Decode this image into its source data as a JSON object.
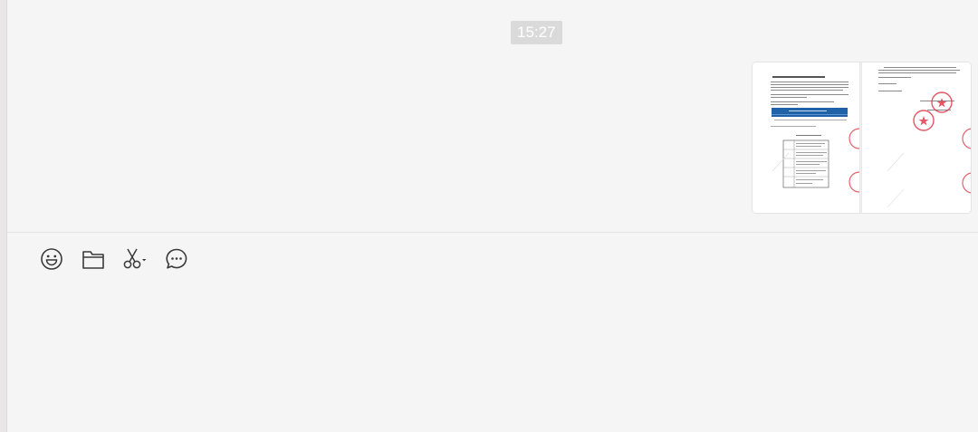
{
  "conversation": {
    "timestamp": "15:27",
    "message": {
      "type": "image",
      "content": "document-scan-with-red-seals"
    }
  },
  "toolbar": {
    "items": [
      {
        "icon": "emoji-icon"
      },
      {
        "icon": "folder-icon"
      },
      {
        "icon": "scissors-screenshot-icon"
      },
      {
        "icon": "chat-history-icon"
      }
    ]
  },
  "colors": {
    "background": "#f5f5f5",
    "timestamp_bg": "#dadada",
    "seal_red": "#e0394a",
    "doc_banner_blue": "#1f62a8",
    "icon_gray": "#3a3a3a"
  }
}
